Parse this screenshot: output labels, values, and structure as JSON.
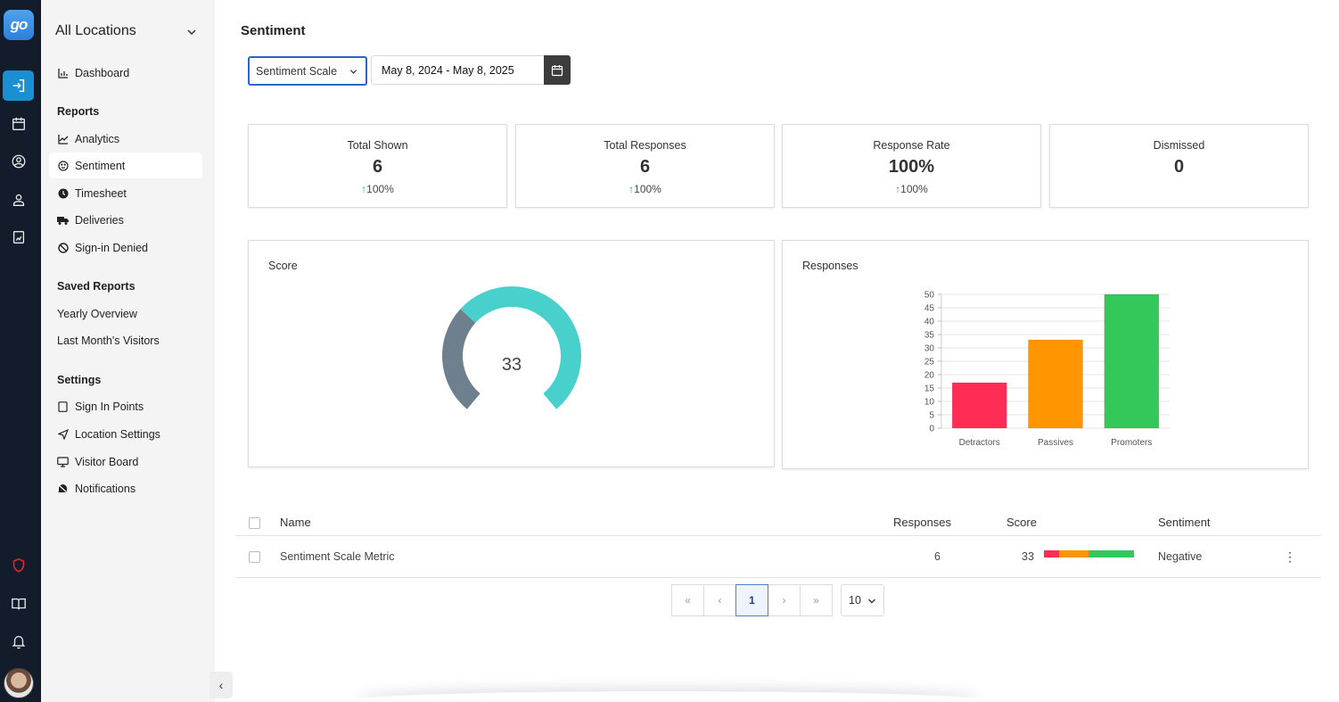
{
  "app": {
    "logo_text": "go"
  },
  "rail": {
    "icons": [
      "sign-in-icon",
      "calendar-icon",
      "user-circle-icon",
      "visitor-icon",
      "report-icon",
      "shield-icon",
      "book-icon",
      "bell-icon"
    ]
  },
  "sidebar": {
    "location": "All Locations",
    "dashboard": "Dashboard",
    "reports_heading": "Reports",
    "reports": [
      "Analytics",
      "Sentiment",
      "Timesheet",
      "Deliveries",
      "Sign-in Denied"
    ],
    "saved_heading": "Saved Reports",
    "saved": [
      "Yearly Overview",
      "Last Month's Visitors"
    ],
    "settings_heading": "Settings",
    "settings": [
      "Sign In Points",
      "Location Settings",
      "Visitor Board",
      "Notifications"
    ]
  },
  "page": {
    "title": "Sentiment"
  },
  "filters": {
    "scale": "Sentiment Scale",
    "date_range": "May 8, 2024 - May 8, 2025"
  },
  "stats": [
    {
      "label": "Total Shown",
      "value": "6",
      "change": "100%"
    },
    {
      "label": "Total Responses",
      "value": "6",
      "change": "100%"
    },
    {
      "label": "Response Rate",
      "value": "100%",
      "change": "100%"
    },
    {
      "label": "Dismissed",
      "value": "0",
      "change": ""
    }
  ],
  "score_card": {
    "title": "Score",
    "value": "33",
    "fraction": 0.33
  },
  "responses_card": {
    "title": "Responses"
  },
  "chart_data": {
    "type": "bar",
    "categories": [
      "Detractors",
      "Passives",
      "Promoters"
    ],
    "values": [
      17,
      33,
      50
    ],
    "colors": [
      "#ff2d55",
      "#ff9500",
      "#34c759"
    ],
    "ylim": [
      0,
      50
    ],
    "yticks": [
      "0",
      "5",
      "10",
      "15",
      "20",
      "25",
      "30",
      "35",
      "40",
      "45",
      "50"
    ],
    "title": "",
    "xlabel": "",
    "ylabel": "",
    "grid": true
  },
  "table": {
    "headers": {
      "name": "Name",
      "responses": "Responses",
      "score": "Score",
      "sentiment": "Sentiment"
    },
    "rows": [
      {
        "name": "Sentiment Scale Metric",
        "responses": "6",
        "score": "33",
        "sentiment": "Negative"
      }
    ]
  },
  "pagination": {
    "first": "«",
    "prev": "‹",
    "current": "1",
    "next": "›",
    "last": "»",
    "per_page": "10"
  },
  "colors": {
    "accent": "#2f64c8",
    "rail": "#131c2b",
    "teal": "#48d1cc",
    "slate": "#6e7f8d"
  }
}
